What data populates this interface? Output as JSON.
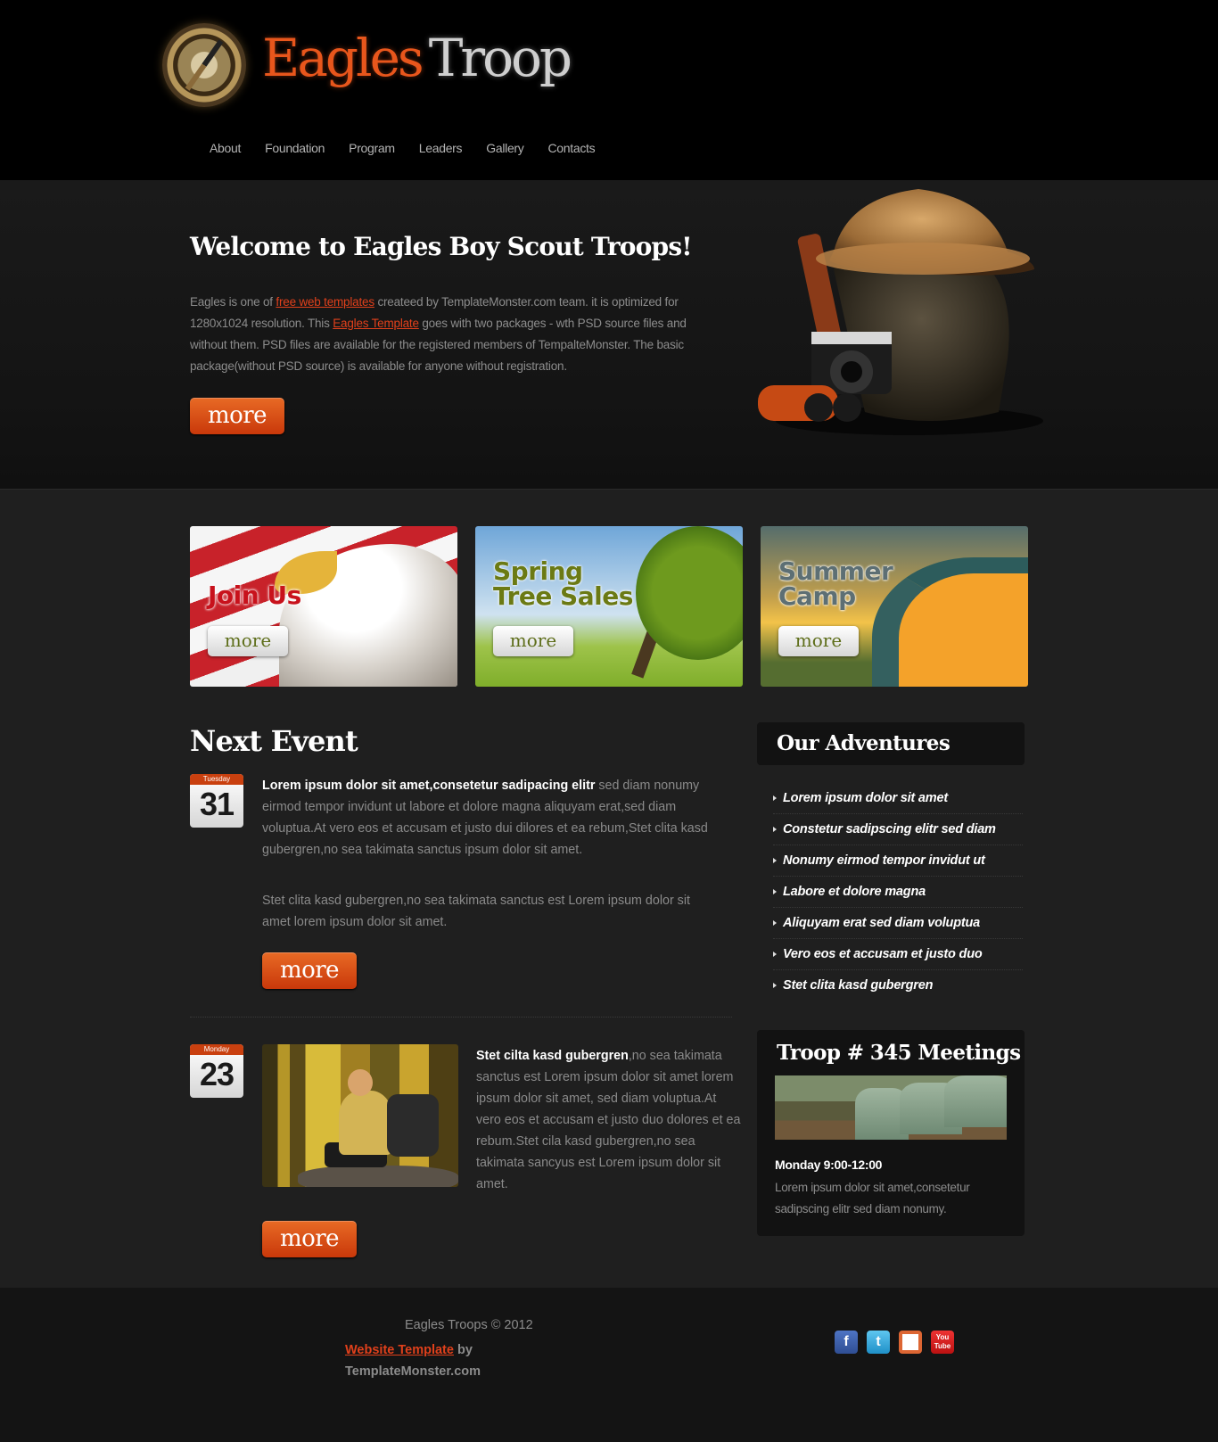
{
  "header": {
    "logo_part1": "Eagles",
    "logo_part2": "Troop",
    "nav": [
      "About",
      "Foundation",
      "Program",
      "Leaders",
      "Gallery",
      "Contacts"
    ]
  },
  "hero": {
    "title": "Welcome to Eagles Boy Scout Troops!",
    "text_1": "Eagles is one of ",
    "link_1": "free web templates",
    "text_2": " createed by TemplateMonster.com team. it is optimized for 1280x1024 resolution. This ",
    "link_2": "Eagles Template",
    "text_3": " goes with two packages - wth PSD source files and without them. PSD files are available for the registered members of TempalteMonster. The basic package(without PSD source) is available for anyone without registration.",
    "more_label": "more"
  },
  "banners": [
    {
      "title": "Join Us",
      "button": "more"
    },
    {
      "title_line1": "Spring",
      "title_line2": "Tree Sales",
      "button": "more"
    },
    {
      "title_line1": "Summer",
      "title_line2": "Camp",
      "button": "more"
    }
  ],
  "events": {
    "section_title": "Next Event",
    "items": [
      {
        "day_name": "Tuesday",
        "day_num": "31",
        "bold": "Lorem ipsum dolor sit amet,consetetur sadipacing elitr",
        "text": " sed diam nonumy eirmod tempor invidunt ut labore et dolore magna aliquyam erat,sed diam voluptua.At vero eos et accusam et justo dui dilores et ea rebum,Stet clita kasd gubergren,no sea takimata sanctus ipsum dolor sit amet.",
        "text2": "Stet clita kasd gubergren,no sea takimata sanctus est Lorem ipsum dolor sit amet lorem ipsum dolor sit amet.",
        "more_label": "more"
      },
      {
        "day_name": "Monday",
        "day_num": "23",
        "bold": "Stet cilta kasd gubergren",
        "text": ",no sea takimata sanctus est Lorem ipsum dolor sit amet lorem ipsum dolor sit amet, sed diam voluptua.At vero eos et accusam et justo duo dolores et ea rebum.Stet cila kasd gubergren,no sea takimata sancyus est Lorem ipsum dolor sit amet.",
        "more_label": "more"
      }
    ]
  },
  "sidebar": {
    "adventures_title": "Our Adventures",
    "adventures": [
      "Lorem ipsum dolor sit amet",
      "Constetur sadipscing elitr sed diam",
      "Nonumy eirmod tempor invidut ut",
      "Labore et dolore magna",
      "Aliquyam erat sed diam voluptua",
      "Vero eos et accusam et justo duo",
      "Stet clita kasd gubergren"
    ],
    "meetings_title": "Troop # 345 Meetings",
    "meetings_time": "Monday 9:00-12:00",
    "meetings_text": "Lorem ipsum dolor sit amet,consetetur sadipscing elitr sed diam nonumy."
  },
  "footer": {
    "copyright": "Eagles Troops © 2012",
    "link": "Website Template",
    "by": " by",
    "company": "TemplateMonster.com",
    "social": [
      {
        "icon": "facebook-icon",
        "glyph": "f"
      },
      {
        "icon": "twitter-icon",
        "glyph": "t"
      },
      {
        "icon": "picasa-icon",
        "glyph": ""
      },
      {
        "icon": "youtube-icon",
        "glyph": "You Tube"
      }
    ]
  },
  "colors": {
    "accent": "#e0401b",
    "button_orange": "#d64b14",
    "background": "#1f1f1f",
    "header": "#000000"
  }
}
